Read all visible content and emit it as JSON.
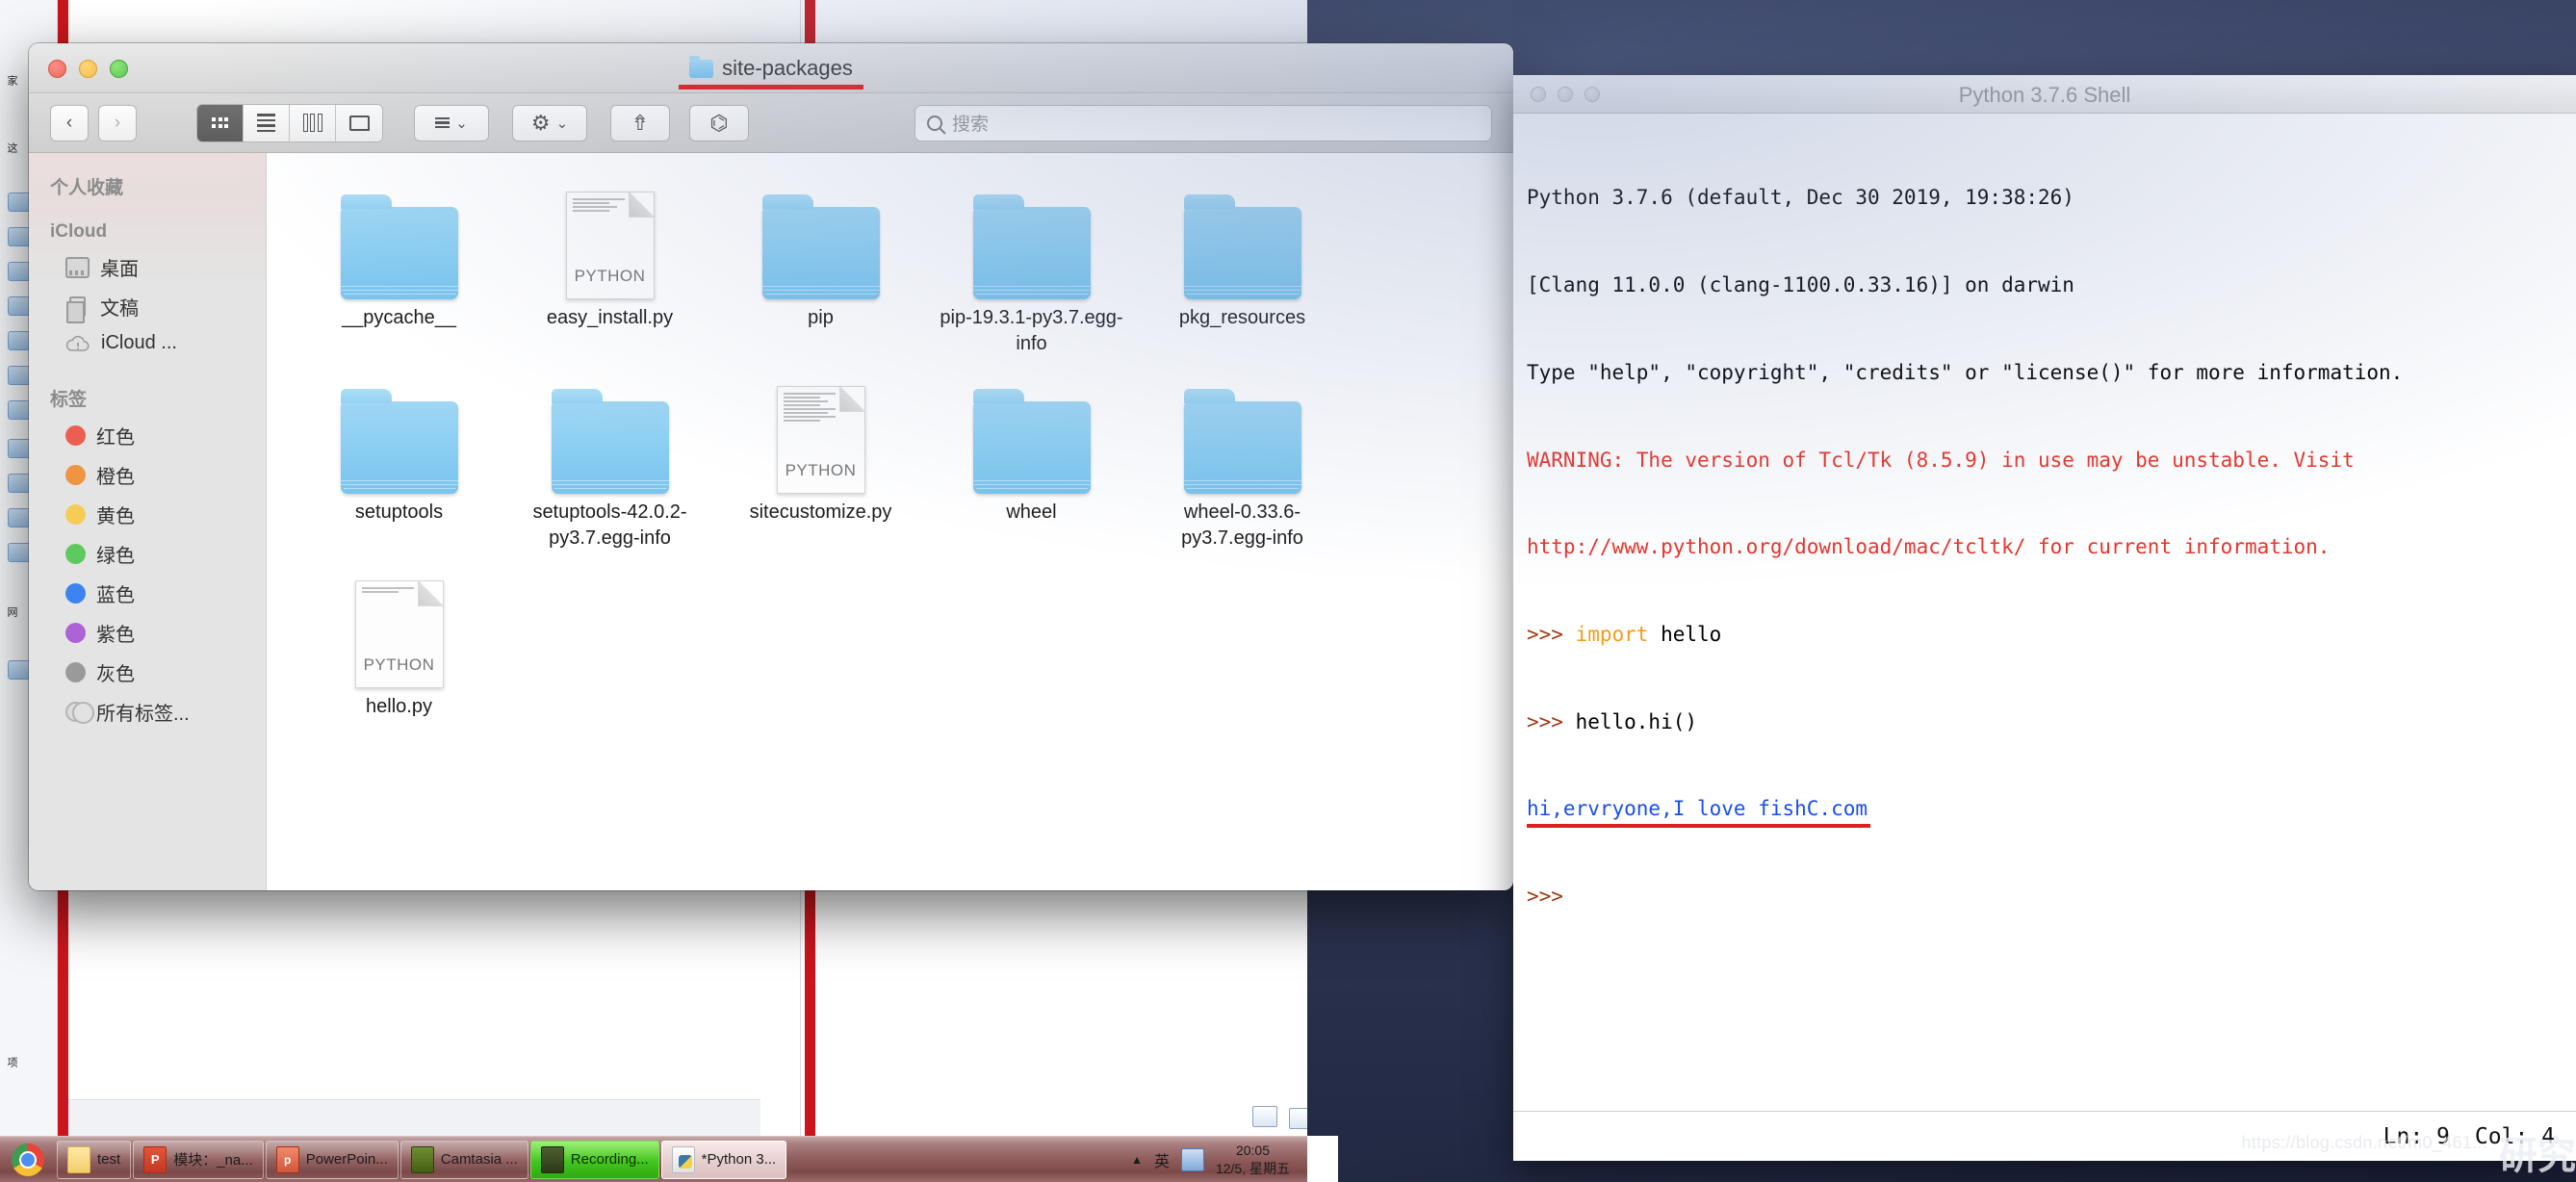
{
  "finder": {
    "title": "site-packages",
    "title_icon": "folder-icon",
    "nav": {
      "back": "‹",
      "forward": "›"
    },
    "view_modes": [
      {
        "name": "icon-view",
        "glyph": "grid-icon",
        "active": true
      },
      {
        "name": "list-view",
        "glyph": "list-icon",
        "active": false
      },
      {
        "name": "column-view",
        "glyph": "columns-icon",
        "active": false
      },
      {
        "name": "gallery-view",
        "glyph": "gallery-icon",
        "active": false
      }
    ],
    "group_button": "group-icon",
    "action_button": "gear-icon",
    "share_button": "share-icon",
    "tag_button": "tag-icon",
    "chevron": "⌄",
    "search": {
      "placeholder": "搜索",
      "value": ""
    },
    "sidebar": {
      "section_favorites": "个人收藏",
      "section_icloud": "iCloud",
      "section_tags": "标签",
      "icloud_items": [
        {
          "label": "桌面",
          "icon": "desktop-icon"
        },
        {
          "label": "文稿",
          "icon": "documents-icon"
        },
        {
          "label": "iCloud ...",
          "icon": "cloud-icon"
        }
      ],
      "tags": [
        {
          "label": "红色",
          "color": "#ec5e51"
        },
        {
          "label": "橙色",
          "color": "#ef9440"
        },
        {
          "label": "黄色",
          "color": "#f5cd56"
        },
        {
          "label": "绿色",
          "color": "#5ec95e"
        },
        {
          "label": "蓝色",
          "color": "#3d84f2"
        },
        {
          "label": "紫色",
          "color": "#ad63d6"
        },
        {
          "label": "灰色",
          "color": "#9a9a9a"
        },
        {
          "label": "所有标签...",
          "color": "ring"
        }
      ]
    },
    "files": [
      {
        "name": "__pycache__",
        "type": "folder"
      },
      {
        "name": "easy_install.py",
        "type": "python",
        "badge": "PYTHON"
      },
      {
        "name": "pip",
        "type": "folder"
      },
      {
        "name": "pip-19.3.1-py3.7.egg-info",
        "type": "folder"
      },
      {
        "name": "pkg_resources",
        "type": "folder"
      },
      {
        "name": "setuptools",
        "type": "folder"
      },
      {
        "name": "setuptools-42.0.2-py3.7.egg-info",
        "type": "folder"
      },
      {
        "name": "sitecustomize.py",
        "type": "python",
        "badge": "PYTHON"
      },
      {
        "name": "wheel",
        "type": "folder"
      },
      {
        "name": "wheel-0.33.6-py3.7.egg-info",
        "type": "folder"
      },
      {
        "name": "hello.py",
        "type": "python",
        "badge": "PYTHON"
      }
    ]
  },
  "pyshell": {
    "title": "Python 3.7.6 Shell",
    "lines": [
      {
        "text": "Python 3.7.6 (default, Dec 30 2019, 19:38:26)",
        "style": "black"
      },
      {
        "text": "[Clang 11.0.0 (clang-1100.0.33.16)] on darwin",
        "style": "black"
      },
      {
        "text": "Type \"help\", \"copyright\", \"credits\" or \"license()\" for more information.",
        "style": "black"
      },
      {
        "text": "WARNING: The version of Tcl/Tk (8.5.9) in use may be unstable. Visit",
        "style": "red"
      },
      {
        "text": "http://www.python.org/download/mac/tcltk/ for current information.",
        "style": "red"
      },
      {
        "prompt": ">>> ",
        "keyword": "import",
        "text": " hello",
        "style": "prompt-kw"
      },
      {
        "prompt": ">>> ",
        "text": "hello.hi()",
        "style": "prompt"
      },
      {
        "text": "hi,ervryone,I love fishC.com",
        "style": "blue-underlined"
      },
      {
        "prompt": ">>> ",
        "text": "",
        "style": "prompt"
      }
    ],
    "status": {
      "ln_label": "Ln: 9",
      "col_label": "Col: 4"
    }
  },
  "taskbar": {
    "start_icon": "chrome-icon",
    "items": [
      {
        "label": "test",
        "icon": "folder-icon",
        "state": "normal"
      },
      {
        "label": "模块：_na...",
        "icon": "powerpoint-icon",
        "state": "normal"
      },
      {
        "label": "PowerPoin...",
        "icon": "powerpoint-small-icon",
        "state": "normal"
      },
      {
        "label": "Camtasia ...",
        "icon": "camtasia-icon",
        "state": "normal"
      },
      {
        "label": "Recording...",
        "icon": "recording-icon",
        "state": "active"
      },
      {
        "label": "*Python 3...",
        "icon": "python-icon",
        "state": "focus"
      }
    ],
    "tray": {
      "arrow": "▲",
      "ime": "英",
      "box_icon": "ime-box-icon"
    },
    "clock": {
      "time": "20:05",
      "date": "12/5, 星期五"
    }
  },
  "win_host": {
    "left_labels": [
      "家",
      "这",
      "网",
      "项"
    ]
  },
  "watermark": {
    "url": "https://blog.csdn.net/m0_461...",
    "text": "研究"
  }
}
